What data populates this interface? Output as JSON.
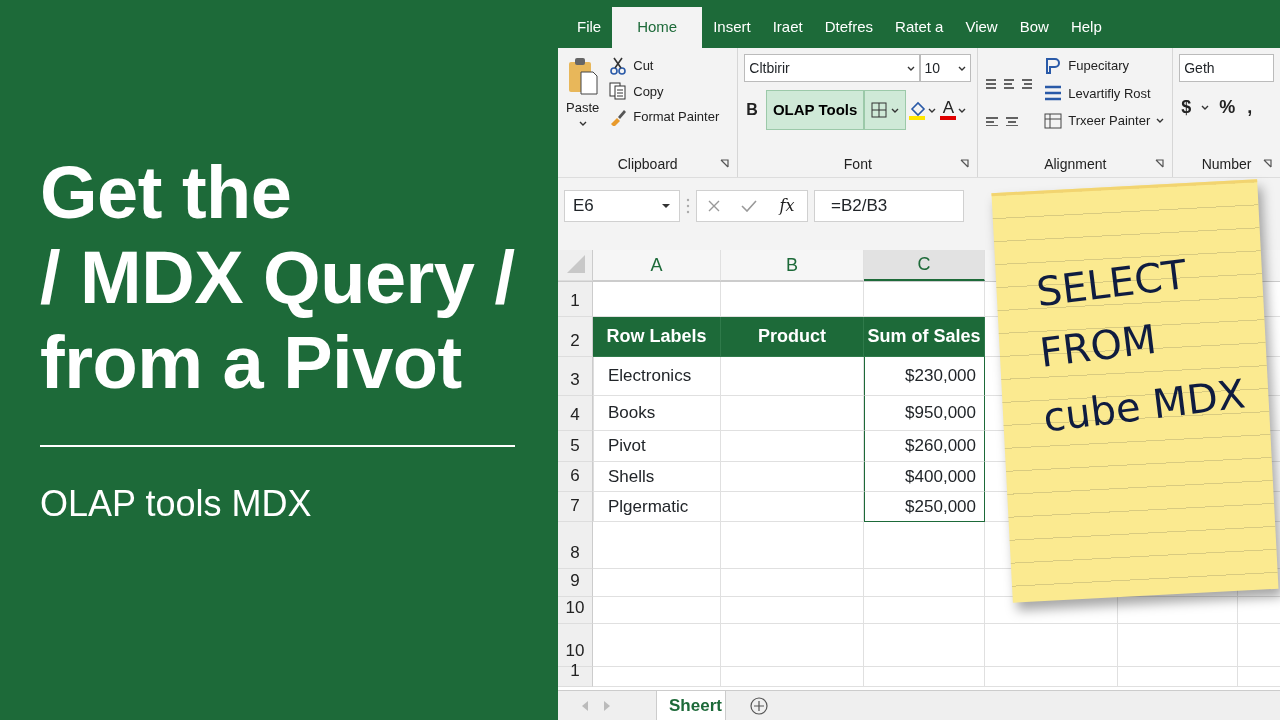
{
  "headline": {
    "lines": [
      "Get the",
      "/ MDX Query /",
      "from a Pivot"
    ],
    "subtitle": "OLAP tools MDX"
  },
  "excel": {
    "tabs": [
      {
        "label": "File",
        "selected": false
      },
      {
        "label": "Home",
        "selected": true
      },
      {
        "label": "Insert",
        "selected": false
      },
      {
        "label": "Iraet",
        "selected": false
      },
      {
        "label": "Dtefres",
        "selected": false
      },
      {
        "label": "Ratet a",
        "selected": false
      },
      {
        "label": "View",
        "selected": false
      },
      {
        "label": "Bow",
        "selected": false
      },
      {
        "label": "Help",
        "selected": false
      }
    ],
    "clipboard": {
      "paste": "Paste",
      "items": [
        "Cut",
        "Copy",
        "Format Painter"
      ],
      "label": "Clipboard"
    },
    "font": {
      "font_name": "Cltbirir",
      "font_size": "10",
      "bold": "B",
      "olap_button": {
        "label": "OLAP Tools",
        "highlighted": true
      },
      "font_color": "A",
      "label": "Font"
    },
    "alignment": {
      "items": [
        "Fupecitary",
        "Levartifly Rost",
        "Trxeer Painter"
      ],
      "label": "Alignment"
    },
    "number": {
      "format": "Geth",
      "symbols": [
        "$",
        "%",
        ","
      ],
      "label": "Number"
    },
    "formula_bar": {
      "name_box": "E6",
      "fx": "fx",
      "formula": "=B2/B3"
    },
    "columns": [
      {
        "label": "A",
        "selected": false
      },
      {
        "label": "B",
        "selected": false
      },
      {
        "label": "C",
        "selected": true
      }
    ],
    "rows": [
      {
        "label": "1",
        "kind": "empty"
      },
      {
        "label": "2",
        "kind": "pivot-header",
        "cells": [
          "Row Labels",
          "Product",
          "Sum of Sales"
        ]
      },
      {
        "label": "3",
        "kind": "data",
        "item": "Electronics",
        "sales": "$230,000"
      },
      {
        "label": "4",
        "kind": "data",
        "item": "Books",
        "sales": "$950,000"
      },
      {
        "label": "5",
        "kind": "data",
        "item": "Pivot",
        "sales": "$260,000"
      },
      {
        "label": "6",
        "kind": "data",
        "item": "Shells",
        "sales": "$400,000"
      },
      {
        "label": "7",
        "kind": "data",
        "item": "Plgermatic",
        "sales": "$250,000"
      },
      {
        "label": "8",
        "kind": "empty"
      },
      {
        "label": "9",
        "kind": "empty"
      },
      {
        "label": "10",
        "kind": "empty"
      },
      {
        "label": "10",
        "kind": "empty"
      },
      {
        "label": "1",
        "kind": "empty"
      }
    ],
    "sheet_tabs": [
      {
        "label": "Sheert",
        "selected": true
      }
    ],
    "note": {
      "lines": [
        "SELECT",
        "FROM",
        "cube MDX"
      ]
    }
  }
}
